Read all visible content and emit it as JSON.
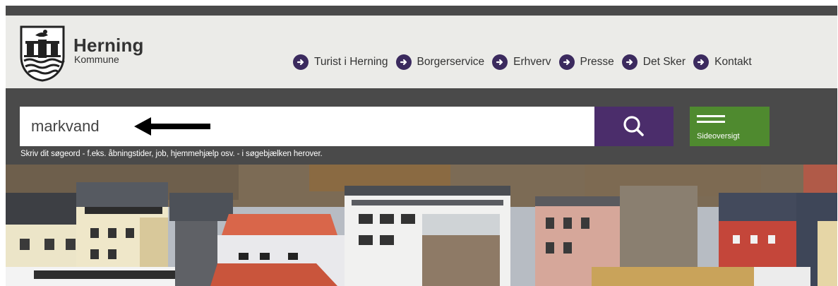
{
  "logo": {
    "name": "Herning",
    "subtitle": "Kommune"
  },
  "nav": {
    "items": [
      {
        "label": "Turist i Herning"
      },
      {
        "label": "Borgerservice"
      },
      {
        "label": "Erhverv"
      },
      {
        "label": "Presse"
      },
      {
        "label": "Det Sker"
      },
      {
        "label": "Kontakt"
      }
    ]
  },
  "search": {
    "value": "markvand",
    "hint": "Skriv dit søgeord - f.eks. åbningstider, job, hjemmehjælp osv. - i søgebjælken herover.",
    "button_icon": "search-icon"
  },
  "sitemap": {
    "label": "Sideoversigt",
    "icon": "hamburger-menu-icon"
  },
  "colors": {
    "dark_bar": "#4a4a4a",
    "header_bg": "#ebebe8",
    "nav_icon": "#3b2a5e",
    "search_button": "#4b2d6b",
    "sitemap_button": "#4f8a2f"
  }
}
